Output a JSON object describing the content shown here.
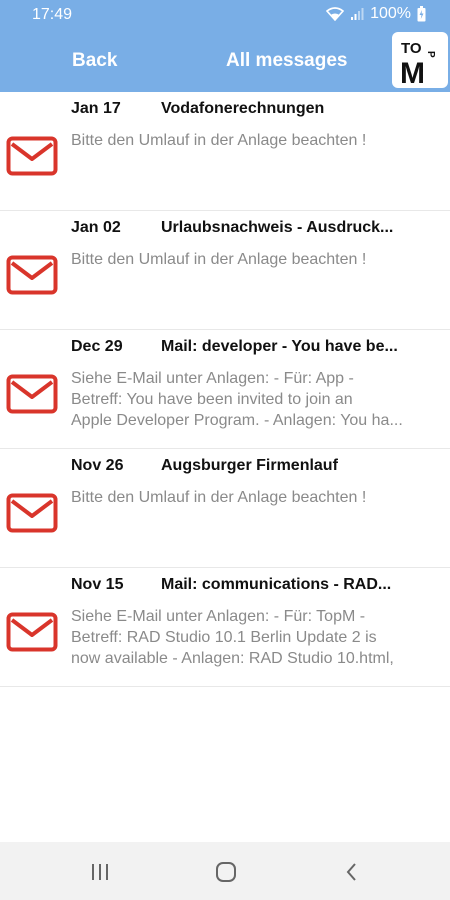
{
  "status_bar": {
    "time": "17:49",
    "battery": "100%"
  },
  "app_bar": {
    "back_label": "Back",
    "title": "All messages",
    "logo_text": [
      "TO",
      "P",
      "M"
    ]
  },
  "colors": {
    "bar": "#79aee6",
    "mail_icon": "#d9352b"
  },
  "messages": [
    {
      "date": "Jan 17",
      "subject": "Vodafonerechnungen",
      "preview": [
        "Bitte den Umlauf in der Anlage beachten !"
      ]
    },
    {
      "date": "Jan 02",
      "subject": "Urlaubsnachweis - Ausdruck...",
      "preview": [
        "Bitte den Umlauf in der Anlage beachten !"
      ]
    },
    {
      "date": "Dec 29",
      "subject": "Mail: developer - You have be...",
      "preview": [
        "Siehe E-Mail unter Anlagen: - Für: App -",
        "Betreff: You have been invited to join an",
        "Apple Developer Program. - Anlagen: You ha..."
      ]
    },
    {
      "date": "Nov 26",
      "subject": "Augsburger Firmenlauf",
      "preview": [
        "Bitte den Umlauf in der Anlage beachten !"
      ]
    },
    {
      "date": "Nov 15",
      "subject": "Mail: communications - RAD...",
      "preview": [
        "Siehe E-Mail unter Anlagen: - Für: TopM -",
        "Betreff: RAD Studio 10.1 Berlin Update 2 is",
        "now available - Anlagen: RAD Studio 10.html,"
      ]
    }
  ],
  "nav_icons": [
    "recent-apps-icon",
    "home-icon",
    "back-icon"
  ]
}
